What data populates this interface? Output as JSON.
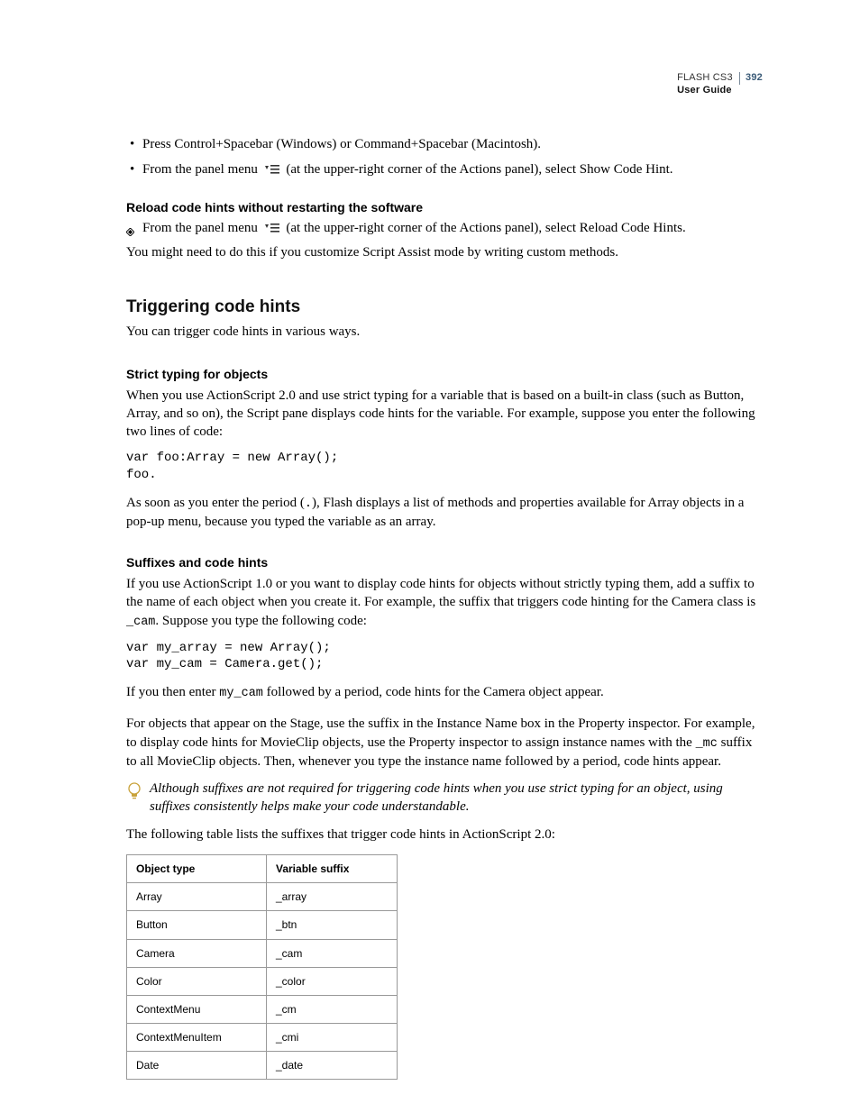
{
  "header": {
    "product": "FLASH CS3",
    "page_number": "392",
    "subtitle": "User Guide"
  },
  "bullets_top": [
    {
      "text": "Press Control+Spacebar (Windows) or Command+Spacebar (Macintosh)."
    },
    {
      "prefix": "From the panel menu",
      "suffix": " (at the upper-right corner of the Actions panel), select Show Code Hint."
    }
  ],
  "reload": {
    "heading": "Reload code hints without restarting the software",
    "step_prefix": "From the panel menu",
    "step_suffix": " (at the upper-right corner of the Actions panel), select Reload Code Hints.",
    "note": "You might need to do this if you customize Script Assist mode by writing custom methods."
  },
  "trigger": {
    "heading": "Triggering code hints",
    "intro": "You can trigger code hints in various ways."
  },
  "strict": {
    "heading": "Strict typing for objects",
    "para1": "When you use ActionScript 2.0 and use strict typing for a variable that is based on a built-in class (such as Button, Array, and so on), the Script pane displays code hints for the variable. For example, suppose you enter the following two lines of code:",
    "code": "var foo:Array = new Array();\nfoo.",
    "para2_pre": "As soon as you enter the period (",
    "para2_period": ".",
    "para2_post": "), Flash displays a list of methods and properties available for Array objects in a pop-up menu, because you typed the variable as an array."
  },
  "suffixes": {
    "heading": "Suffixes and code hints",
    "para1_pre": "If you use ActionScript 1.0 or you want to display code hints for objects without strictly typing them, add a suffix to the name of each object when you create it. For example, the suffix that triggers code hinting for the Camera class is ",
    "para1_code": "_cam",
    "para1_post": ". Suppose you type the following code:",
    "code": "var my_array = new Array();\nvar my_cam = Camera.get();",
    "para2_pre": "If you then enter ",
    "para2_code": "my_cam",
    "para2_post": " followed by a period, code hints for the Camera object appear.",
    "para3_pre": "For objects that appear on the Stage, use the suffix in the Instance Name box in the Property inspector. For example, to display code hints for MovieClip objects, use the Property inspector to assign instance names with the ",
    "para3_code": "_mc",
    "para3_post": " suffix to all MovieClip objects. Then, whenever you type the instance name followed by a period, code hints appear.",
    "tip": "Although suffixes are not required for triggering code hints when you use strict typing for an object, using suffixes consistently helps make your code understandable.",
    "table_intro": "The following table lists the suffixes that trigger code hints in ActionScript 2.0:"
  },
  "chart_data": {
    "type": "table",
    "columns": [
      "Object type",
      "Variable suffix"
    ],
    "rows": [
      [
        "Array",
        "_array"
      ],
      [
        "Button",
        "_btn"
      ],
      [
        "Camera",
        "_cam"
      ],
      [
        "Color",
        "_color"
      ],
      [
        "ContextMenu",
        "_cm"
      ],
      [
        "ContextMenuItem",
        "_cmi"
      ],
      [
        "Date",
        "_date"
      ]
    ]
  }
}
